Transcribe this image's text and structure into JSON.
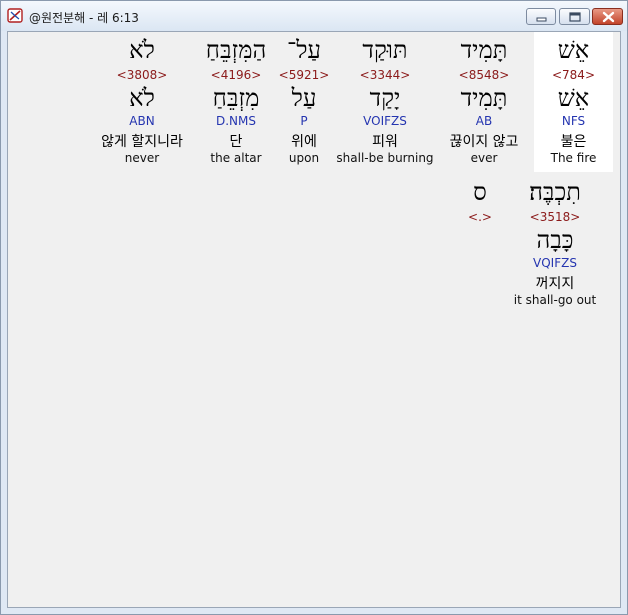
{
  "window": {
    "title": "@원전분해 - 레 6:13"
  },
  "words": [
    {
      "hebrew": "אֵשׁ",
      "strong": "<784>",
      "lexeme": "אֵשׁ",
      "parse": "NFS",
      "korean": "불은",
      "english": "The fire",
      "selected": true
    },
    {
      "hebrew": "תָּמִיד",
      "strong": "<8548>",
      "lexeme": "תָּמִיד",
      "parse": "AB",
      "korean": "끊이지 않고",
      "english": "ever"
    },
    {
      "hebrew": "תּוּקַד",
      "strong": "<3344>",
      "lexeme": "יָקַד",
      "parse": "VOIFZS",
      "korean": "피워",
      "english": "shall-be burning"
    },
    {
      "hebrew": "עַל־",
      "strong": "<5921>",
      "lexeme": "עַל",
      "parse": "P",
      "korean": "위에",
      "english": "upon"
    },
    {
      "hebrew": "הַמִּזְבֵּחַ",
      "strong": "<4196>",
      "lexeme": "מִזְבֵּחַ",
      "parse": "D.NMS",
      "korean": "단",
      "english": "the altar"
    },
    {
      "hebrew": "לֹא",
      "strong": "<3808>",
      "lexeme": "לֹא",
      "parse": "ABN",
      "korean": "않게 할지니라",
      "english": "never"
    },
    {
      "hebrew": "תִכְבֶּה׃",
      "strong": "<3518>",
      "lexeme": "כָּבָה",
      "parse": "VQIFZS",
      "korean": "꺼지지",
      "english": "it shall-go out"
    },
    {
      "hebrew": "ס",
      "strong": "<.>",
      "lexeme": "",
      "parse": "",
      "korean": "",
      "english": ""
    }
  ]
}
